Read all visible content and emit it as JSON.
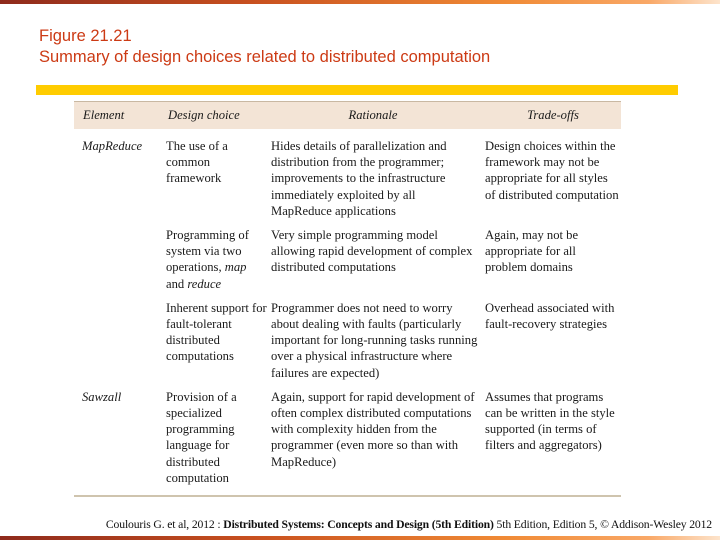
{
  "slide": {
    "figure_label": "Figure 21.21",
    "caption": "Summary of design choices related to distributed computation",
    "colors": {
      "title": "#cc3a14",
      "accent_band": "#ffcc00",
      "table_header_bg": "#f3e4d6",
      "top_bar_start": "#8e2a1c",
      "top_bar_end": "#fde4cc"
    }
  },
  "table": {
    "headers": {
      "element": "Element",
      "design_choice": "Design choice",
      "rationale": "Rationale",
      "tradeoffs": "Trade-offs"
    },
    "rows": [
      {
        "element": "MapReduce",
        "design_choice": "The use of a common framework",
        "rationale": "Hides details of parallelization and distribution from the programmer; improvements to the infrastructure immediately exploited by all MapReduce applications",
        "tradeoffs": "Design choices within the framework may not be appropriate for all styles of distributed computation"
      },
      {
        "element": "",
        "design_choice_parts": {
          "before": "Programming of system via two operations, ",
          "em1": "map",
          "middle": " and ",
          "em2": "reduce"
        },
        "rationale": "Very simple programming model allowing rapid development of complex distributed computations",
        "tradeoffs": "Again, may not be appropriate for all problem domains"
      },
      {
        "element": "",
        "design_choice": "Inherent support for fault-tolerant distributed computations",
        "rationale": "Programmer does not need to worry about dealing with faults (particularly important for long-running tasks running over a physical infrastructure where failures are expected)",
        "tradeoffs": "Overhead associated with fault-recovery strategies"
      },
      {
        "element": "Sawzall",
        "design_choice": "Provision of a specialized programming language for distributed computation",
        "rationale": "Again, support for rapid development of often complex distributed computations with complexity hidden from the programmer (even more so than with MapReduce)",
        "tradeoffs": "Assumes that programs can be written in the style supported (in terms of filters and aggregators)"
      }
    ]
  },
  "footer": {
    "prefix": "Coulouris G. et al, 2012 : ",
    "book_title": "Distributed Systems: Concepts and Design (5th Edition)",
    "suffix": " 5th Edition, Edition 5, © Addison-Wesley 2012"
  }
}
